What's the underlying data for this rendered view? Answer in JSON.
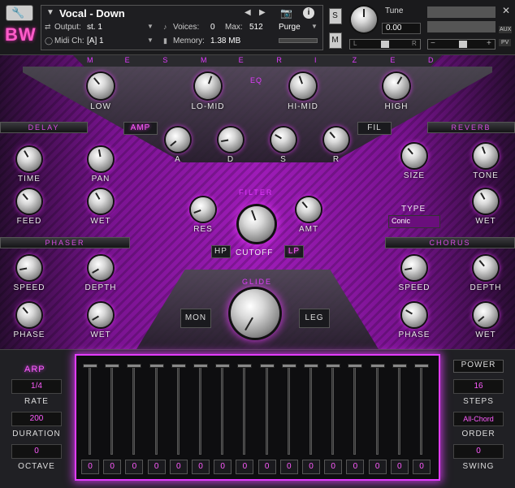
{
  "header": {
    "logo": "BW",
    "instrument_name": "Vocal - Down",
    "output_label": "Output:",
    "output_value": "st. 1",
    "midi_label": "Midi Ch:",
    "midi_value": "[A] 1",
    "voices_label": "Voices:",
    "voices_value": "0",
    "max_label": "Max:",
    "max_value": "512",
    "memory_label": "Memory:",
    "memory_value": "1.38 MB",
    "purge_label": "Purge",
    "solo_label": "S",
    "mute_label": "M",
    "tune_label": "Tune",
    "tune_value": "0.00",
    "pan_left": "L",
    "pan_right": "R",
    "aux_label": "AUX",
    "pv_label": "PV",
    "vol_minus": "−",
    "vol_plus": "+"
  },
  "brand": {
    "title_letters": [
      "M",
      "E",
      "S",
      "M",
      "E",
      "R",
      "I",
      "Z",
      "E",
      "D"
    ]
  },
  "eq": {
    "label": "EQ",
    "knobs": [
      {
        "label": "LOW"
      },
      {
        "label": "LO-MID"
      },
      {
        "label": "HI-MID"
      },
      {
        "label": "HIGH"
      }
    ]
  },
  "envelope": {
    "amp_label": "AMP",
    "fil_label": "FIL",
    "knobs": [
      {
        "label": "A"
      },
      {
        "label": "D"
      },
      {
        "label": "S"
      },
      {
        "label": "R"
      }
    ]
  },
  "delay": {
    "title": "DELAY",
    "knobs": [
      {
        "label": "TIME"
      },
      {
        "label": "PAN"
      },
      {
        "label": "FEED"
      },
      {
        "label": "WET"
      }
    ]
  },
  "reverb": {
    "title": "REVERB",
    "knobs": [
      {
        "label": "SIZE"
      },
      {
        "label": "TONE"
      },
      {
        "label": "WET"
      }
    ],
    "type_label": "TYPE",
    "type_value": "Conic"
  },
  "filter": {
    "title": "FILTER",
    "res_label": "RES",
    "amt_label": "AMT",
    "cutoff_label": "CUTOFF",
    "hp_label": "HP",
    "lp_label": "LP"
  },
  "phaser": {
    "title": "PHASER",
    "knobs": [
      {
        "label": "SPEED"
      },
      {
        "label": "DEPTH"
      },
      {
        "label": "PHASE"
      },
      {
        "label": "WET"
      }
    ]
  },
  "chorus": {
    "title": "CHORUS",
    "knobs": [
      {
        "label": "SPEED"
      },
      {
        "label": "DEPTH"
      },
      {
        "label": "PHASE"
      },
      {
        "label": "WET"
      }
    ]
  },
  "glide": {
    "title": "GLIDE",
    "mon_label": "MON",
    "leg_label": "LEG"
  },
  "arp": {
    "title": "ARP",
    "rate_value": "1/4",
    "rate_label": "RATE",
    "duration_value": "200",
    "duration_label": "DURATION",
    "octave_value": "0",
    "octave_label": "OCTAVE",
    "power_label": "POWER",
    "steps_value": "16",
    "steps_label": "STEPS",
    "order_value": "All-Chord",
    "order_label": "ORDER",
    "swing_value": "0",
    "swing_label": "SWING"
  },
  "sequencer": {
    "steps": [
      "0",
      "0",
      "0",
      "0",
      "0",
      "0",
      "0",
      "0",
      "0",
      "0",
      "0",
      "0",
      "0",
      "0",
      "0",
      "0"
    ]
  }
}
